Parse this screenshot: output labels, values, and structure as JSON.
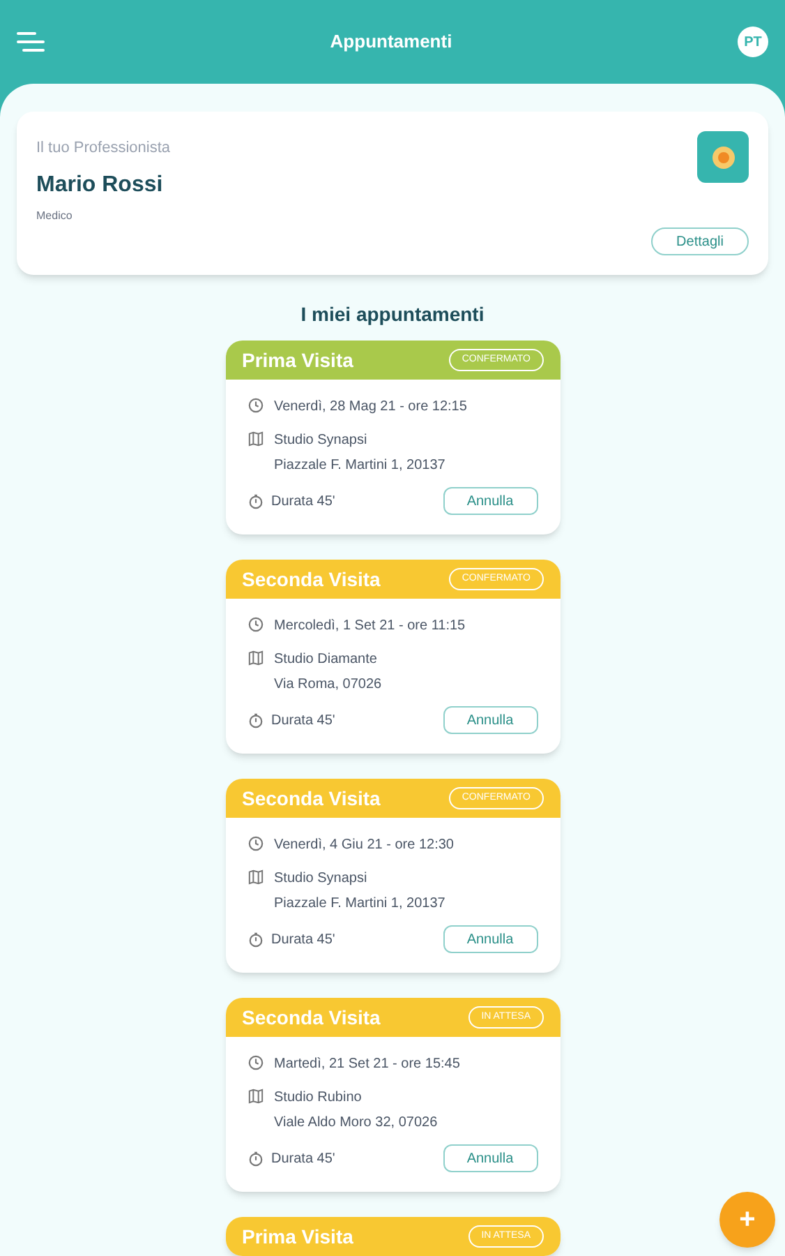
{
  "header": {
    "title": "Appuntamenti",
    "avatar": "PT"
  },
  "professional": {
    "label": "Il tuo Professionista",
    "name": "Mario Rossi",
    "role": "Medico",
    "button": "Dettagli"
  },
  "section_title": "I miei appuntamenti",
  "appointments": [
    {
      "title": "Prima Visita",
      "status": "CONFERMATO",
      "color": "#a9c94b",
      "date": "Venerdì, 28 Mag 21 - ore 12:15",
      "place": "Studio Synapsi",
      "address": "Piazzale F. Martini 1, 20137",
      "duration": "Durata 45'",
      "button": "Annulla"
    },
    {
      "title": "Seconda Visita",
      "status": "CONFERMATO",
      "color": "#f8c832",
      "date": "Mercoledì, 1 Set 21 - ore 11:15",
      "place": "Studio Diamante",
      "address": "Via Roma, 07026",
      "duration": "Durata 45'",
      "button": "Annulla"
    },
    {
      "title": "Seconda Visita",
      "status": "CONFERMATO",
      "color": "#f8c832",
      "date": "Venerdì, 4 Giu 21 - ore 12:30",
      "place": "Studio Synapsi",
      "address": "Piazzale F. Martini 1, 20137",
      "duration": "Durata 45'",
      "button": "Annulla"
    },
    {
      "title": "Seconda Visita",
      "status": "IN ATTESA",
      "color": "#f8c832",
      "date": "Martedì, 21 Set 21 - ore 15:45",
      "place": "Studio Rubino",
      "address": "Viale Aldo Moro 32, 07026",
      "duration": "Durata 45'",
      "button": "Annulla"
    },
    {
      "title": "Prima Visita",
      "status": "IN ATTESA",
      "color": "#f8c832"
    }
  ],
  "fab": "+"
}
